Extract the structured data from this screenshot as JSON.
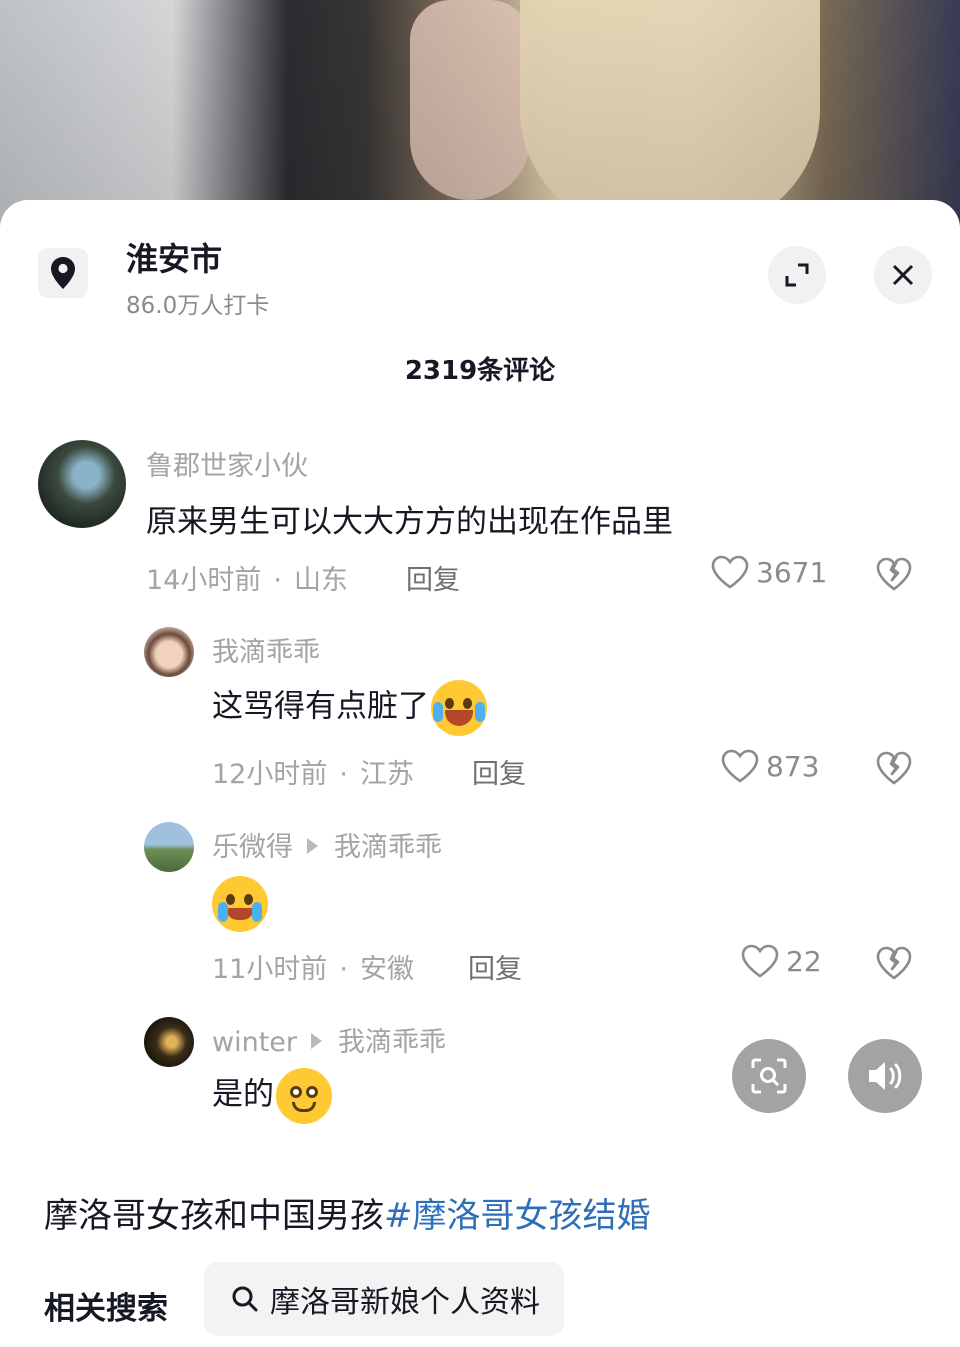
{
  "location": {
    "name": "淮安市",
    "checkins": "86.0万人打卡",
    "icon": "location-pin-icon"
  },
  "header": {
    "comment_count": "2319条评论",
    "expand_icon": "expand-icon",
    "close_icon": "close-icon"
  },
  "comments": [
    {
      "user": "鲁郡世家小伙",
      "text": "原来男生可以大大方方的出现在作品里",
      "time": "14小时前",
      "region": "山东",
      "reply_label": "回复",
      "likes": "3671"
    },
    {
      "user": "我滴乖乖",
      "text": "这骂得有点脏了",
      "emoji": "crying-laughing-emoji",
      "time": "12小时前",
      "region": "江苏",
      "reply_label": "回复",
      "likes": "873"
    },
    {
      "user": "乐微得",
      "reply_to": "我滴乖乖",
      "emoji": "crying-emoji",
      "time": "11小时前",
      "region": "安徽",
      "reply_label": "回复",
      "likes": "22"
    },
    {
      "user": "winter",
      "reply_to": "我滴乖乖",
      "text": "是的",
      "emoji": "smiling-emoji"
    }
  ],
  "floating": {
    "scan_icon": "image-search-icon",
    "sound_icon": "speaker-icon"
  },
  "caption": {
    "text": "摩洛哥女孩和中国男孩",
    "hashtag": "#摩洛哥女孩结婚"
  },
  "related": {
    "label": "相关搜索",
    "query": "摩洛哥新娘个人资料",
    "icon": "search-icon"
  },
  "colors": {
    "hashtag": "#2f6fb8",
    "muted": "#a3a4a8",
    "primary_text": "#161823"
  }
}
